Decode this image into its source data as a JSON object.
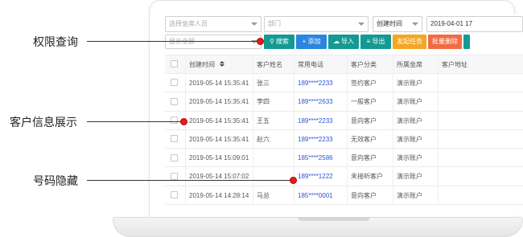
{
  "filters": {
    "seat_placeholder": "选择坐席人员",
    "department_placeholder": "部门",
    "date_field": "创建时间",
    "date_value": "2019-04-01 17",
    "display_all": "显示全部"
  },
  "toolbar": {
    "search": "搜索",
    "add": "添加",
    "import": "导入",
    "export": "导出",
    "start_task": "发起任务",
    "batch_delete": "批量删除"
  },
  "table": {
    "headers": {
      "created": "创建时间",
      "name": "客户姓名",
      "phone": "常用电话",
      "category": "客户分类",
      "seat": "所属坐席",
      "address": "客户地址"
    },
    "rows": [
      {
        "created": "2019-05-14 15:35:41",
        "name": "张三",
        "phone": "189****2233",
        "category": "签约客户",
        "seat": "演示账户"
      },
      {
        "created": "2019-05-14 15:35:41",
        "name": "李四",
        "phone": "189****2633",
        "category": "一般客户",
        "seat": "演示账户"
      },
      {
        "created": "2019-05-14 15:35:41",
        "name": "王五",
        "phone": "189****2233",
        "category": "意向客户",
        "seat": "演示账户"
      },
      {
        "created": "2019-05-14 15:35:41",
        "name": "赵六",
        "phone": "189****2233",
        "category": "无效客户",
        "seat": "演示账户"
      },
      {
        "created": "2019-05-14 15:09:01",
        "name": "",
        "phone": "185****2586",
        "category": "意向客户",
        "seat": "演示账户"
      },
      {
        "created": "2019-05-14 15:07:02",
        "name": "",
        "phone": "189****1222",
        "category": "未接听客户",
        "seat": "演示账户"
      },
      {
        "created": "2019-05-14 14:28:14",
        "name": "马总",
        "phone": "185****0001",
        "category": "意向客户",
        "seat": "演示账户"
      }
    ]
  },
  "annotations": {
    "permission_query": "权限查询",
    "info_display": "客户信息展示",
    "number_hidden": "号码隐藏"
  },
  "colors": {
    "teal": "#139a92",
    "blue": "#2b86e0",
    "orange": "#f5a623",
    "red_orange": "#f06c43",
    "phone_link": "#2a55d4",
    "annotation_dot": "#e11d1d"
  }
}
